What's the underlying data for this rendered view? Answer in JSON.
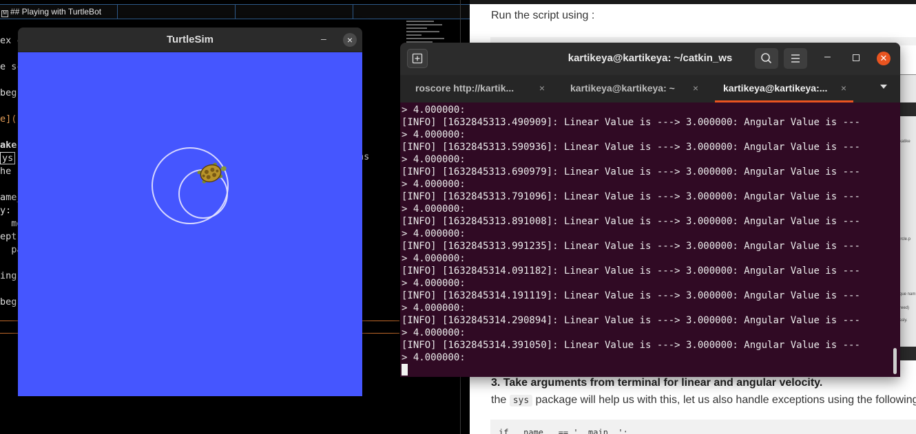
{
  "editor": {
    "tab_title": "## Playing with TurtleBot",
    "code_lines": [
      {
        "text": "ex c",
        "cls": ""
      },
      {
        "text": "",
        "cls": ""
      },
      {
        "text": "e sc",
        "cls": ""
      },
      {
        "text": "",
        "cls": ""
      },
      {
        "text": "beg",
        "cls": ""
      },
      {
        "text": "",
        "cls": ""
      },
      {
        "text": "e](",
        "cls": "orange"
      },
      {
        "text": "",
        "cls": ""
      },
      {
        "text": "ake",
        "cls": "bold"
      },
      {
        "text": "ys",
        "cls": "boxed"
      },
      {
        "text": "he",
        "cls": ""
      },
      {
        "text": "",
        "cls": ""
      },
      {
        "text": "ame_",
        "cls": ""
      },
      {
        "text": "y:",
        "cls": ""
      },
      {
        "text": "  mo",
        "cls": ""
      },
      {
        "text": "ept",
        "cls": ""
      },
      {
        "text": "  pa",
        "cls": ""
      },
      {
        "text": "",
        "cls": ""
      },
      {
        "text": "ing",
        "cls": ""
      },
      {
        "text": "",
        "cls": ""
      },
      {
        "text": "beg",
        "cls": ""
      }
    ],
    "right_fragment": "ns"
  },
  "doc": {
    "run_text": "Run the script using :",
    "image_labels": [
      "katike",
      "ircle.p",
      "que nam",
      "reed)",
      "ssly."
    ],
    "heading": "3. Take arguments from terminal for linear and angular velocity.",
    "para_before": "the ",
    "para_code": "sys",
    "para_after": " package will help us with this, let us also handle exceptions using the following",
    "code_snippet": "if __name__ == '__main__':"
  },
  "turtlesim": {
    "title": "TurtleSim",
    "minimize": "–",
    "close": "×",
    "background": "#4556ff",
    "trail_color": "#e6e6ff"
  },
  "terminal": {
    "title": "kartikeya@kartikeya: ~/catkin_ws",
    "tabs": [
      {
        "label": "roscore http://kartik...",
        "active": false
      },
      {
        "label": "kartikeya@kartikeya: ~",
        "active": false
      },
      {
        "label": "kartikeya@kartikeya:...",
        "active": true
      }
    ],
    "tab_close": "×",
    "lines": [
      "> 4.000000:",
      "[INFO] [1632845313.490909]: Linear Value is ---> 3.000000: Angular Value is ---",
      "> 4.000000:",
      "[INFO] [1632845313.590936]: Linear Value is ---> 3.000000: Angular Value is ---",
      "> 4.000000:",
      "[INFO] [1632845313.690979]: Linear Value is ---> 3.000000: Angular Value is ---",
      "> 4.000000:",
      "[INFO] [1632845313.791096]: Linear Value is ---> 3.000000: Angular Value is ---",
      "> 4.000000:",
      "[INFO] [1632845313.891008]: Linear Value is ---> 3.000000: Angular Value is ---",
      "> 4.000000:",
      "[INFO] [1632845313.991235]: Linear Value is ---> 3.000000: Angular Value is ---",
      "> 4.000000:",
      "[INFO] [1632845314.091182]: Linear Value is ---> 3.000000: Angular Value is ---",
      "> 4.000000:",
      "[INFO] [1632845314.191119]: Linear Value is ---> 3.000000: Angular Value is ---",
      "> 4.000000:",
      "[INFO] [1632845314.290894]: Linear Value is ---> 3.000000: Angular Value is ---",
      "> 4.000000:",
      "[INFO] [1632845314.391050]: Linear Value is ---> 3.000000: Angular Value is ---",
      "> 4.000000:"
    ],
    "accent": "#e95420",
    "background": "#300a24"
  }
}
